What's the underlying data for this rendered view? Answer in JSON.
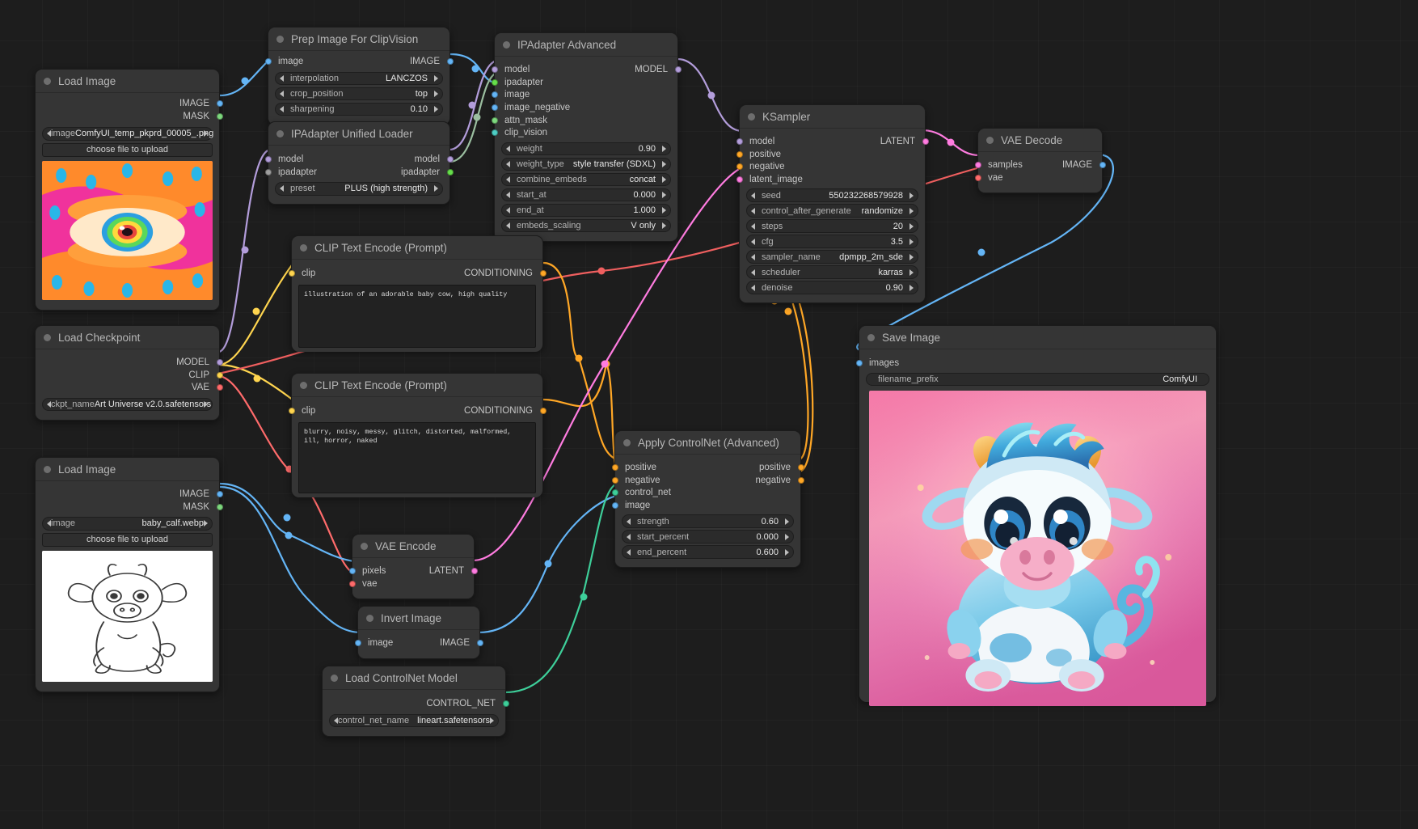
{
  "app": {
    "name": "ComfyUI",
    "canvas_bg": "#1d1d1d"
  },
  "nodes": {
    "load_image_1": {
      "title": "Load Image",
      "outputs": [
        {
          "label": "IMAGE",
          "color": "#64b5f6"
        },
        {
          "label": "MASK",
          "color": "#7ed87e"
        }
      ],
      "widgets": [
        {
          "name": "image",
          "value": "ComfyUI_temp_pkprd_00005_.png"
        }
      ],
      "button": "choose file to upload",
      "preview_alt": "psychedelic dripping eye artwork"
    },
    "prep_image": {
      "title": "Prep Image For ClipVision",
      "inputs": [
        {
          "label": "image",
          "color": "#64b5f6"
        }
      ],
      "outputs": [
        {
          "label": "IMAGE",
          "color": "#64b5f6"
        }
      ],
      "widgets": [
        {
          "name": "interpolation",
          "value": "LANCZOS"
        },
        {
          "name": "crop_position",
          "value": "top"
        },
        {
          "name": "sharpening",
          "value": "0.10"
        }
      ]
    },
    "ipadapter_unified_loader": {
      "title": "IPAdapter Unified Loader",
      "inputs": [
        {
          "label": "model",
          "color": "#b39ddb"
        },
        {
          "label": "ipadapter",
          "color": "#9e9e9e"
        }
      ],
      "outputs": [
        {
          "label": "model",
          "color": "#b39ddb"
        },
        {
          "label": "ipadapter",
          "color": "#66de4b"
        }
      ],
      "widgets": [
        {
          "name": "preset",
          "value": "PLUS (high strength)"
        }
      ]
    },
    "ipadapter_advanced": {
      "title": "IPAdapter Advanced",
      "inputs": [
        {
          "label": "model",
          "color": "#b39ddb"
        },
        {
          "label": "ipadapter",
          "color": "#66de4b"
        },
        {
          "label": "image",
          "color": "#64b5f6"
        },
        {
          "label": "image_negative",
          "color": "#64b5f6"
        },
        {
          "label": "attn_mask",
          "color": "#7ed87e"
        },
        {
          "label": "clip_vision",
          "color": "#4ecdc4"
        }
      ],
      "outputs": [
        {
          "label": "MODEL",
          "color": "#b39ddb"
        }
      ],
      "widgets": [
        {
          "name": "weight",
          "value": "0.90"
        },
        {
          "name": "weight_type",
          "value": "style transfer (SDXL)"
        },
        {
          "name": "combine_embeds",
          "value": "concat"
        },
        {
          "name": "start_at",
          "value": "0.000"
        },
        {
          "name": "end_at",
          "value": "1.000"
        },
        {
          "name": "embeds_scaling",
          "value": "V only"
        }
      ]
    },
    "ksampler": {
      "title": "KSampler",
      "inputs": [
        {
          "label": "model",
          "color": "#b39ddb"
        },
        {
          "label": "positive",
          "color": "#ffa726"
        },
        {
          "label": "negative",
          "color": "#ffa726"
        },
        {
          "label": "latent_image",
          "color": "#ff7ce0"
        }
      ],
      "outputs": [
        {
          "label": "LATENT",
          "color": "#ff7ce0"
        }
      ],
      "widgets": [
        {
          "name": "seed",
          "value": "550232268579928"
        },
        {
          "name": "control_after_generate",
          "value": "randomize"
        },
        {
          "name": "steps",
          "value": "20"
        },
        {
          "name": "cfg",
          "value": "3.5"
        },
        {
          "name": "sampler_name",
          "value": "dpmpp_2m_sde"
        },
        {
          "name": "scheduler",
          "value": "karras"
        },
        {
          "name": "denoise",
          "value": "0.90"
        }
      ]
    },
    "vae_decode": {
      "title": "VAE Decode",
      "inputs": [
        {
          "label": "samples",
          "color": "#ff7ce0"
        },
        {
          "label": "vae",
          "color": "#ff6b6b"
        }
      ],
      "outputs": [
        {
          "label": "IMAGE",
          "color": "#64b5f6"
        }
      ]
    },
    "load_checkpoint": {
      "title": "Load Checkpoint",
      "outputs": [
        {
          "label": "MODEL",
          "color": "#b39ddb"
        },
        {
          "label": "CLIP",
          "color": "#ffd54f"
        },
        {
          "label": "VAE",
          "color": "#ff6b6b"
        }
      ],
      "widgets": [
        {
          "name": "ckpt_name",
          "value": "Art Universe v2.0.safetensors"
        }
      ]
    },
    "clip_positive": {
      "title": "CLIP Text Encode (Prompt)",
      "inputs": [
        {
          "label": "clip",
          "color": "#ffd54f"
        }
      ],
      "outputs": [
        {
          "label": "CONDITIONING",
          "color": "#ffa726"
        }
      ],
      "text": "illustration of an adorable baby cow, high quality"
    },
    "clip_negative": {
      "title": "CLIP Text Encode (Prompt)",
      "inputs": [
        {
          "label": "clip",
          "color": "#ffd54f"
        }
      ],
      "outputs": [
        {
          "label": "CONDITIONING",
          "color": "#ffa726"
        }
      ],
      "text": "blurry, noisy, messy, glitch, distorted, malformed, ill, horror, naked"
    },
    "load_image_2": {
      "title": "Load Image",
      "outputs": [
        {
          "label": "IMAGE",
          "color": "#64b5f6"
        },
        {
          "label": "MASK",
          "color": "#7ed87e"
        }
      ],
      "widgets": [
        {
          "name": "image",
          "value": "baby_calf.webp"
        }
      ],
      "button": "choose file to upload",
      "preview_alt": "line art sketch of a baby calf"
    },
    "vae_encode": {
      "title": "VAE Encode",
      "inputs": [
        {
          "label": "pixels",
          "color": "#64b5f6"
        },
        {
          "label": "vae",
          "color": "#ff6b6b"
        }
      ],
      "outputs": [
        {
          "label": "LATENT",
          "color": "#ff7ce0"
        }
      ]
    },
    "invert_image": {
      "title": "Invert Image",
      "inputs": [
        {
          "label": "image",
          "color": "#64b5f6"
        }
      ],
      "outputs": [
        {
          "label": "IMAGE",
          "color": "#64b5f6"
        }
      ]
    },
    "load_controlnet": {
      "title": "Load ControlNet Model",
      "outputs": [
        {
          "label": "CONTROL_NET",
          "color": "#4ecdc4"
        }
      ],
      "widgets": [
        {
          "name": "control_net_name",
          "value": "lineart.safetensors"
        }
      ]
    },
    "apply_controlnet": {
      "title": "Apply ControlNet (Advanced)",
      "inputs": [
        {
          "label": "positive",
          "color": "#ffa726"
        },
        {
          "label": "negative",
          "color": "#ffa726"
        },
        {
          "label": "control_net",
          "color": "#4ecdc4"
        },
        {
          "label": "image",
          "color": "#64b5f6"
        }
      ],
      "outputs": [
        {
          "label": "positive",
          "color": "#ffa726"
        },
        {
          "label": "negative",
          "color": "#ffa726"
        }
      ],
      "widgets": [
        {
          "name": "strength",
          "value": "0.60"
        },
        {
          "name": "start_percent",
          "value": "0.000"
        },
        {
          "name": "end_percent",
          "value": "0.600"
        }
      ]
    },
    "save_image": {
      "title": "Save Image",
      "inputs": [
        {
          "label": "images",
          "color": "#64b5f6"
        }
      ],
      "widgets": [
        {
          "name": "filename_prefix",
          "value": "ComfyUI"
        }
      ],
      "preview_alt": "blue haired cartoon baby cow on pink background"
    }
  }
}
